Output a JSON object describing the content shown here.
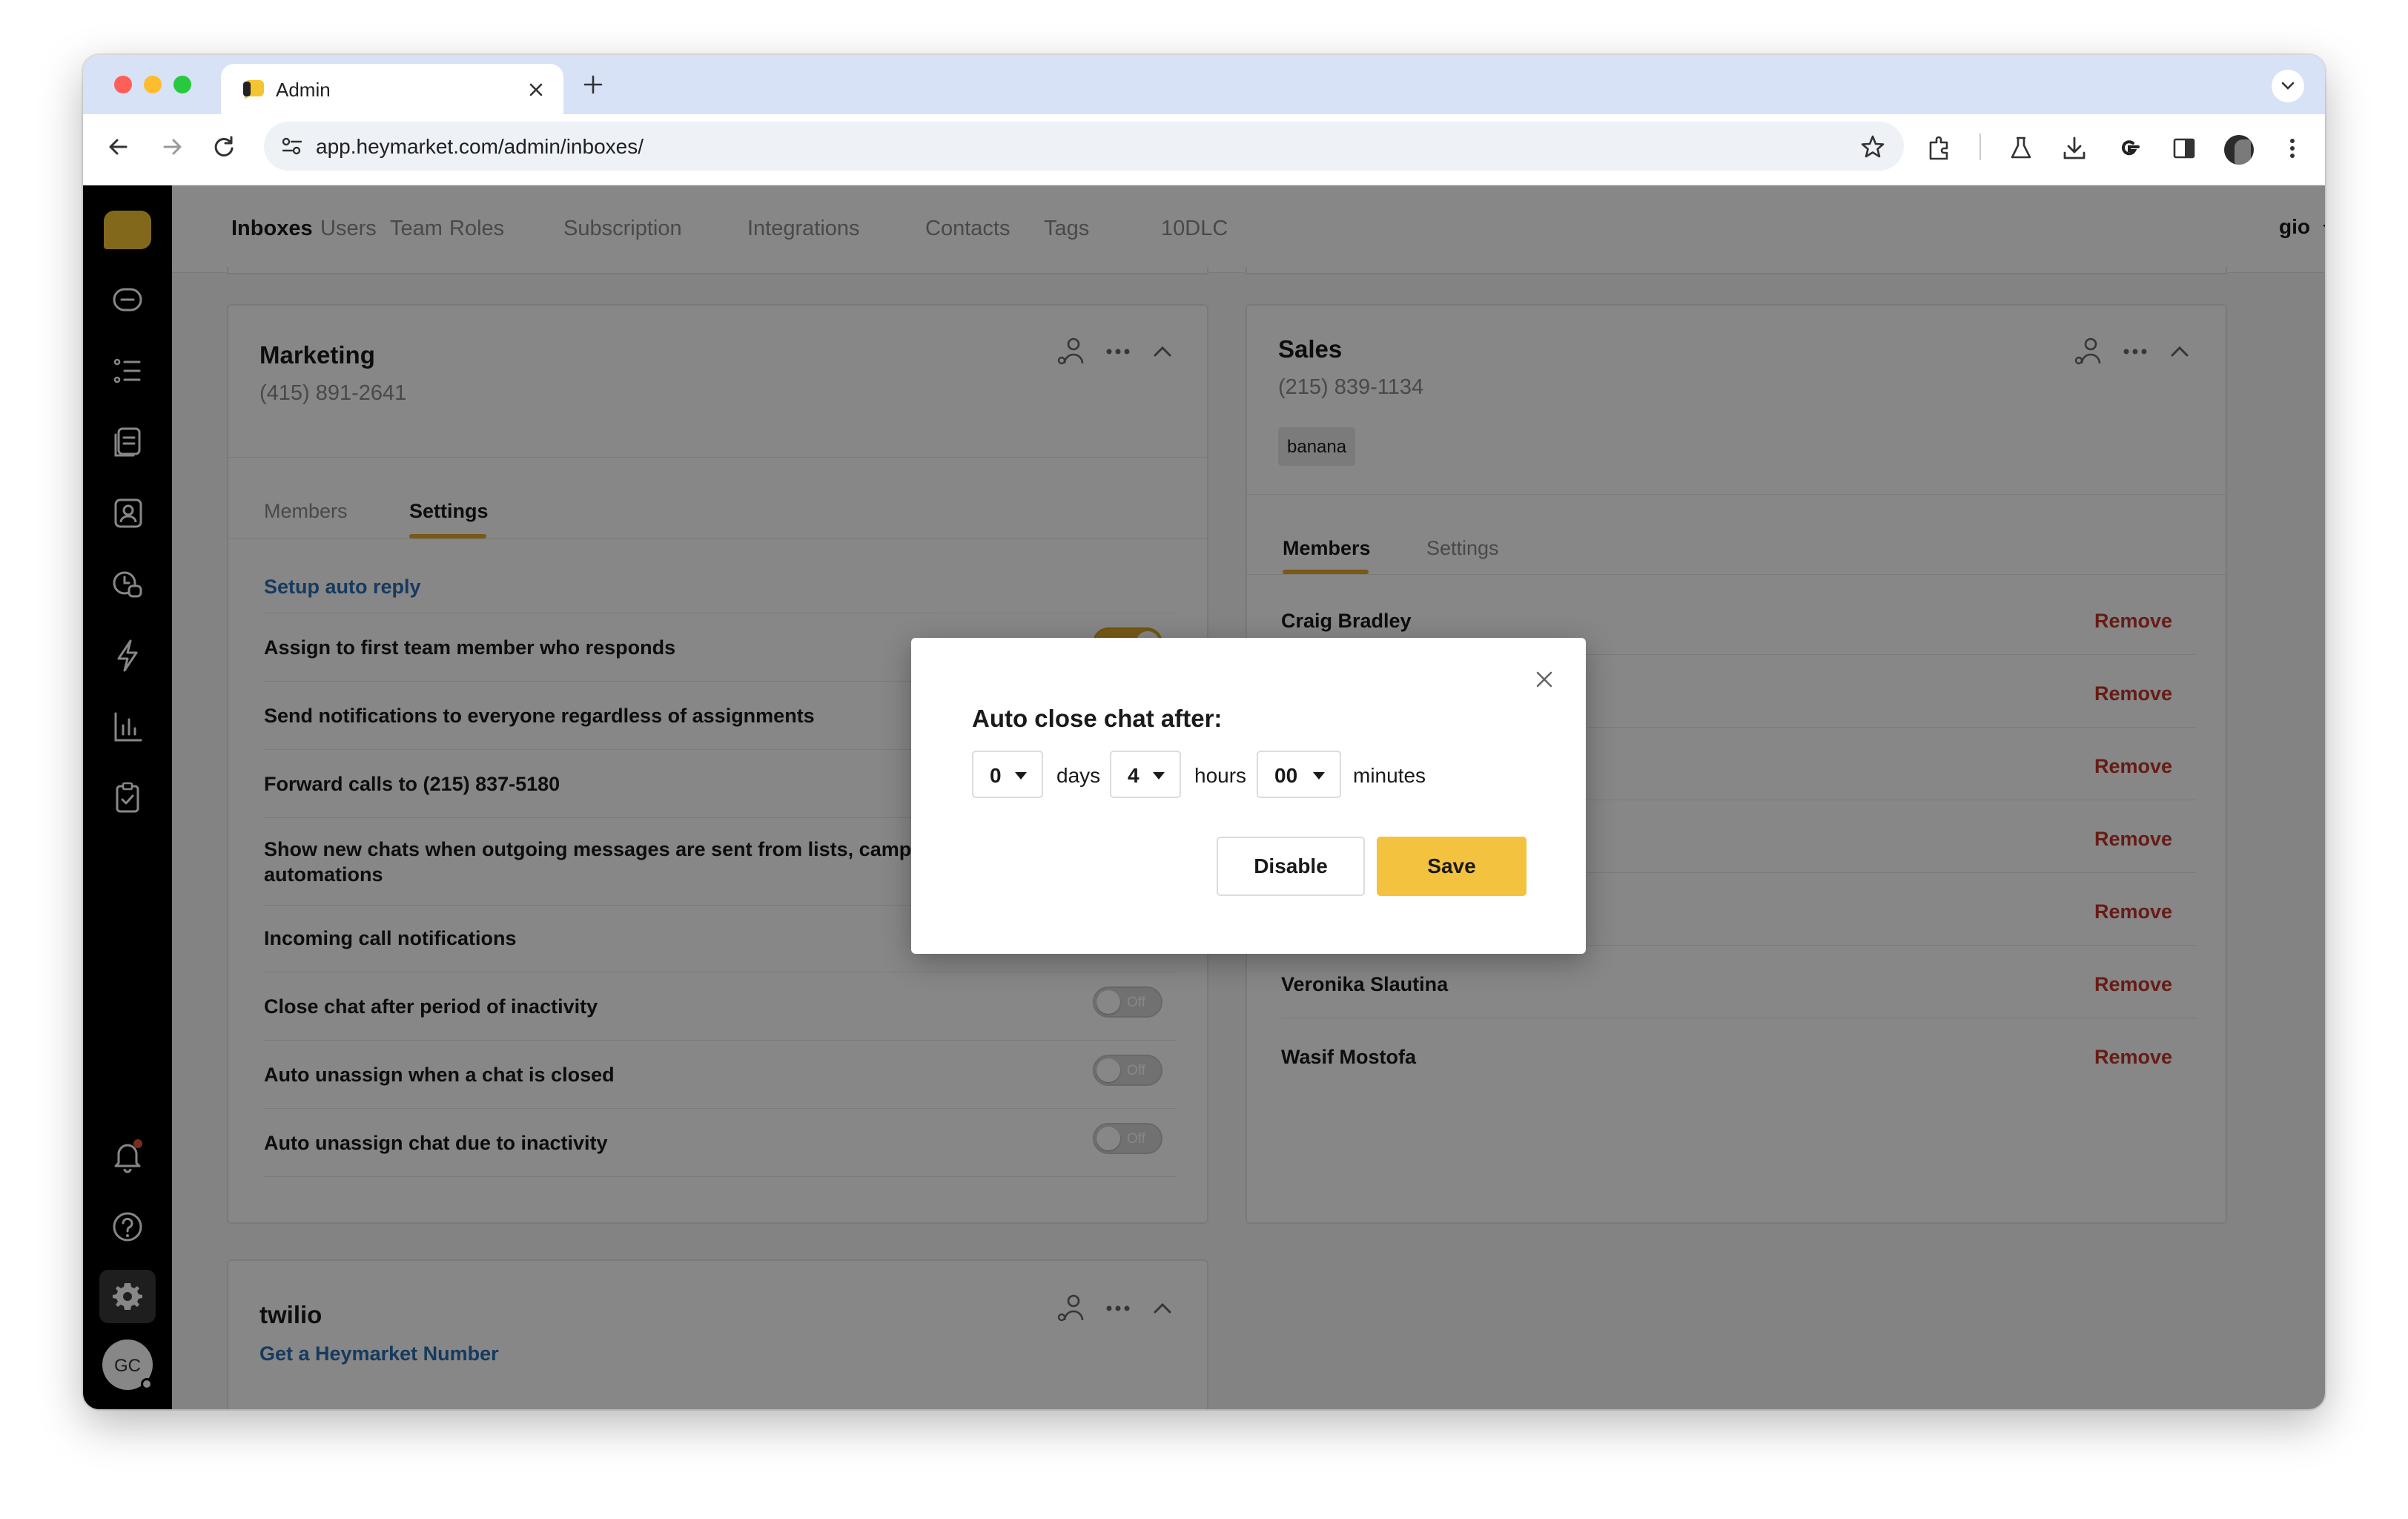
{
  "browser": {
    "tab_title": "Admin",
    "url": "app.heymarket.com/admin/inboxes/"
  },
  "nav": {
    "items": [
      "Inboxes",
      "Users",
      "Team",
      "Roles",
      "Subscription",
      "Integrations",
      "Contacts",
      "Tags",
      "10DLC"
    ],
    "active": "Inboxes",
    "user_menu": "gio"
  },
  "sidebar": {
    "avatar_initials": "GC"
  },
  "marketing": {
    "title": "Marketing",
    "phone": "(415) 891-2641",
    "tabs": [
      "Members",
      "Settings"
    ],
    "active_tab": "Settings",
    "setup_link": "Setup auto reply",
    "settings": [
      {
        "label": "Assign to first team member who responds",
        "state": "on"
      },
      {
        "label": "Send notifications to everyone regardless of assignments",
        "state": "on"
      },
      {
        "label": "Forward calls to (215) 837-5180",
        "state": "on"
      },
      {
        "label": "Show new chats when outgoing messages are sent from lists, campa",
        "label2": "automations",
        "state": "on"
      },
      {
        "label": "Incoming call notifications",
        "state": "on"
      },
      {
        "label": "Close chat after period of inactivity",
        "state": "off"
      },
      {
        "label": "Auto unassign when a chat is closed",
        "state": "off"
      },
      {
        "label": "Auto unassign chat due to inactivity",
        "state": "off"
      }
    ],
    "off_text": "Off"
  },
  "sales": {
    "title": "Sales",
    "phone": "(215) 839-1134",
    "tag": "banana",
    "tabs": [
      "Members",
      "Settings"
    ],
    "active_tab": "Members",
    "members": [
      "Craig Bradley",
      "",
      "",
      "",
      "",
      "Veronika Slautina",
      "Wasif Mostofa"
    ],
    "remove_label": "Remove"
  },
  "twilio": {
    "title": "twilio",
    "link": "Get a Heymarket Number"
  },
  "modal": {
    "title": "Auto close chat after:",
    "days_value": "0",
    "days_label": "days",
    "hours_value": "4",
    "hours_label": "hours",
    "minutes_value": "00",
    "minutes_label": "minutes",
    "disable_label": "Disable",
    "save_label": "Save"
  },
  "colors": {
    "accent": "#e2a92b",
    "save_button": "#f3c23f",
    "remove": "#c0352b",
    "link": "#2b6fb3"
  }
}
